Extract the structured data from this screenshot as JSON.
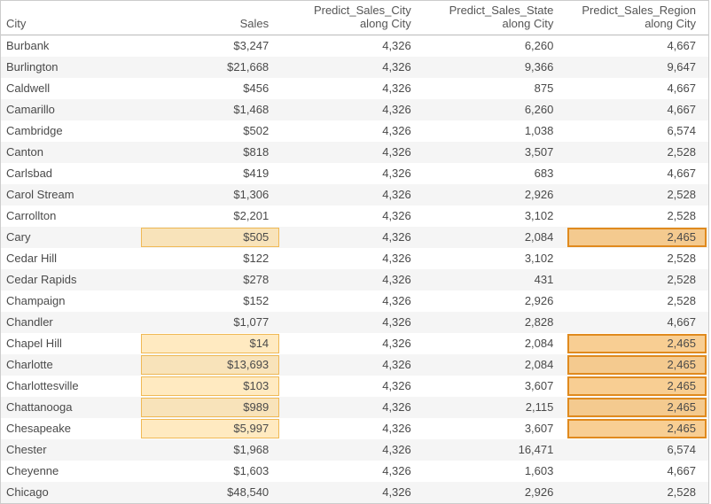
{
  "columns": {
    "city": "City",
    "sales": "Sales",
    "pred_city": "Predict_Sales_City\nalong City",
    "pred_state": "Predict_Sales_State\nalong City",
    "pred_region": "Predict_Sales_Region\nalong City"
  },
  "rows": [
    {
      "city": "Burbank",
      "sales": "$3,247",
      "pc": "4,326",
      "ps": "6,260",
      "pr": "4,667"
    },
    {
      "city": "Burlington",
      "sales": "$21,668",
      "pc": "4,326",
      "ps": "9,366",
      "pr": "9,647"
    },
    {
      "city": "Caldwell",
      "sales": "$456",
      "pc": "4,326",
      "ps": "875",
      "pr": "4,667"
    },
    {
      "city": "Camarillo",
      "sales": "$1,468",
      "pc": "4,326",
      "ps": "6,260",
      "pr": "4,667"
    },
    {
      "city": "Cambridge",
      "sales": "$502",
      "pc": "4,326",
      "ps": "1,038",
      "pr": "6,574"
    },
    {
      "city": "Canton",
      "sales": "$818",
      "pc": "4,326",
      "ps": "3,507",
      "pr": "2,528"
    },
    {
      "city": "Carlsbad",
      "sales": "$419",
      "pc": "4,326",
      "ps": "683",
      "pr": "4,667"
    },
    {
      "city": "Carol Stream",
      "sales": "$1,306",
      "pc": "4,326",
      "ps": "2,926",
      "pr": "2,528"
    },
    {
      "city": "Carrollton",
      "sales": "$2,201",
      "pc": "4,326",
      "ps": "3,102",
      "pr": "2,528"
    },
    {
      "city": "Cary",
      "sales": "$505",
      "pc": "4,326",
      "ps": "2,084",
      "pr": "2,465",
      "hl_sales": "light",
      "hl_pr": "dark"
    },
    {
      "city": "Cedar Hill",
      "sales": "$122",
      "pc": "4,326",
      "ps": "3,102",
      "pr": "2,528"
    },
    {
      "city": "Cedar Rapids",
      "sales": "$278",
      "pc": "4,326",
      "ps": "431",
      "pr": "2,528"
    },
    {
      "city": "Champaign",
      "sales": "$152",
      "pc": "4,326",
      "ps": "2,926",
      "pr": "2,528"
    },
    {
      "city": "Chandler",
      "sales": "$1,077",
      "pc": "4,326",
      "ps": "2,828",
      "pr": "4,667"
    },
    {
      "city": "Chapel Hill",
      "sales": "$14",
      "pc": "4,326",
      "ps": "2,084",
      "pr": "2,465",
      "hl_sales": "light",
      "hl_pr": "dark"
    },
    {
      "city": "Charlotte",
      "sales": "$13,693",
      "pc": "4,326",
      "ps": "2,084",
      "pr": "2,465",
      "hl_sales": "light",
      "hl_pr": "dark"
    },
    {
      "city": "Charlottesville",
      "sales": "$103",
      "pc": "4,326",
      "ps": "3,607",
      "pr": "2,465",
      "hl_sales": "light",
      "hl_pr": "dark"
    },
    {
      "city": "Chattanooga",
      "sales": "$989",
      "pc": "4,326",
      "ps": "2,115",
      "pr": "2,465",
      "hl_sales": "light",
      "hl_pr": "dark"
    },
    {
      "city": "Chesapeake",
      "sales": "$5,997",
      "pc": "4,326",
      "ps": "3,607",
      "pr": "2,465",
      "hl_sales": "light",
      "hl_pr": "dark"
    },
    {
      "city": "Chester",
      "sales": "$1,968",
      "pc": "4,326",
      "ps": "16,471",
      "pr": "6,574"
    },
    {
      "city": "Cheyenne",
      "sales": "$1,603",
      "pc": "4,326",
      "ps": "1,603",
      "pr": "4,667"
    },
    {
      "city": "Chicago",
      "sales": "$48,540",
      "pc": "4,326",
      "ps": "2,926",
      "pr": "2,528"
    }
  ]
}
